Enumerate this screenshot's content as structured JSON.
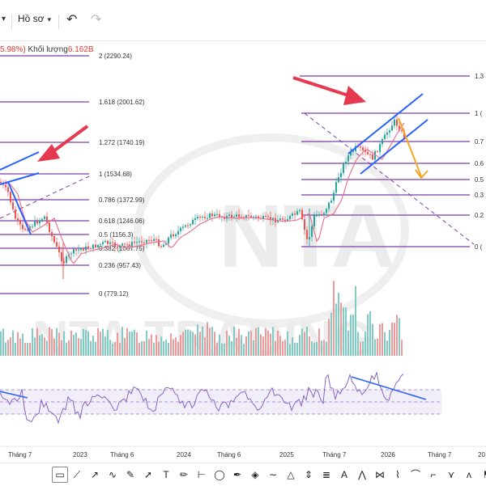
{
  "topbar": {
    "profile_label": "Hồ sơ",
    "profile_chevron": "chevron-down-icon",
    "undo_icon": "undo-icon",
    "redo_icon": "redo-icon"
  },
  "legend": {
    "pct": "5.98%)",
    "volume_label": "Khối lượng",
    "volume_value": "6.162B"
  },
  "fib_left": [
    {
      "ratio": "2",
      "value": "(2290.24)"
    },
    {
      "ratio": "1.618",
      "value": "(2001.62)"
    },
    {
      "ratio": "1.272",
      "value": "(1740.19)"
    },
    {
      "ratio": "1",
      "value": "(1534.68)"
    },
    {
      "ratio": "0.786",
      "value": "(1372.99)"
    },
    {
      "ratio": "0.618",
      "value": "(1246.06)"
    },
    {
      "ratio": "0.5",
      "value": "(1156.3)"
    },
    {
      "ratio": "0.382",
      "value": "(1067.75)"
    },
    {
      "ratio": "0.236",
      "value": "(957.43)"
    },
    {
      "ratio": "0",
      "value": "(779.12)"
    }
  ],
  "fib_right": [
    {
      "ratio": "1.3"
    },
    {
      "ratio": "1 ("
    },
    {
      "ratio": "0.7"
    },
    {
      "ratio": "0.6"
    },
    {
      "ratio": "0.5"
    },
    {
      "ratio": "0.3"
    },
    {
      "ratio": "0.2"
    },
    {
      "ratio": "0 ("
    }
  ],
  "time_axis": [
    "Tháng 7",
    "2023",
    "Tháng 6",
    "2024",
    "Tháng 6",
    "2025",
    "Tháng 7",
    "2026",
    "Tháng 7",
    "20"
  ],
  "watermark": {
    "logo": "NTA",
    "text": "NTA TRADING"
  },
  "colors": {
    "up": "#26a69a",
    "down": "#ef5350",
    "fib": "#7b3fa8",
    "arrow": "#e53950",
    "channel": "#2962ff",
    "ma": "#ec6a8c",
    "rsi": "#7e57c2",
    "projection": "#f5a623"
  },
  "toolbar": {
    "tools": [
      "rectangle-icon",
      "trend-line-icon",
      "path-icon",
      "polyline-icon",
      "brush-icon",
      "arrow-icon",
      "text-icon",
      "pencil-icon",
      "ruler-icon",
      "circle-icon",
      "pen-icon",
      "shapes-icon",
      "sine-wave-icon",
      "triangle-icon",
      "price-range-icon",
      "fib-icon",
      "font-icon",
      "abc-pattern-icon",
      "xabcd-pattern-icon",
      "elliott-wave-icon",
      "curve-icon",
      "elbow-icon",
      "zigzag-icon",
      "abcd-pattern-icon",
      "flag-icon"
    ]
  }
}
